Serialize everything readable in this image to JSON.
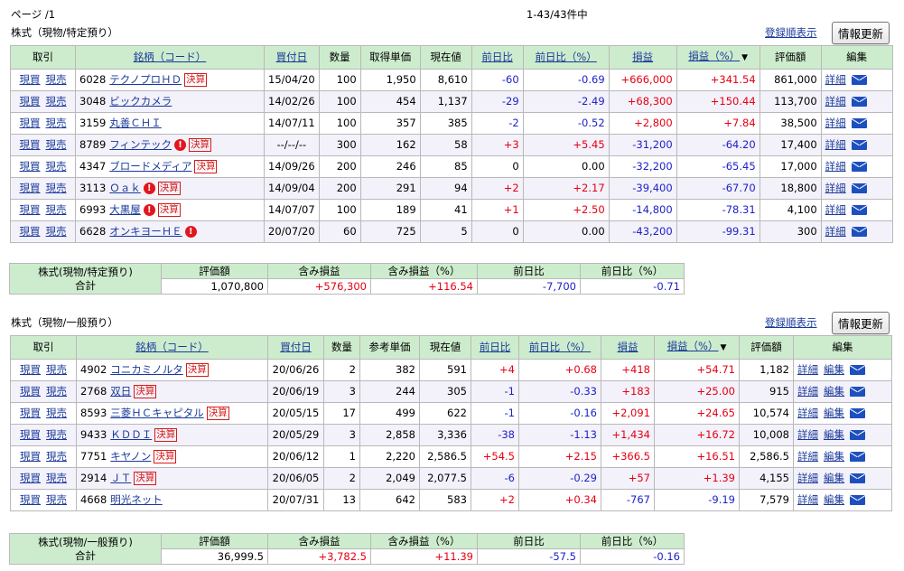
{
  "pager": {
    "left": "ページ /1",
    "count": "1-43/43件中"
  },
  "shared": {
    "buy": "現買",
    "sell": "現売",
    "detail": "詳細",
    "edit": "編集",
    "kessan": "決算",
    "alert": "!",
    "sort_glyph": "▼",
    "sort_link": "登録順表示",
    "refresh_button": "情報更新"
  },
  "colors": {
    "header_bg": "#cdeccd",
    "positive": "#e60012",
    "negative": "#1e22c8",
    "link": "#1a3a9a"
  },
  "tokutei": {
    "title": "株式（現物/特定預り）",
    "headers": [
      "取引",
      "銘柄（コード）",
      "買付日",
      "数量",
      "取得単価",
      "現在値",
      "前日比",
      "前日比（%）",
      "損益",
      "損益（%）",
      "評価額",
      "編集"
    ],
    "rows": [
      {
        "code": "6028",
        "name": "テクノプロＨＤ",
        "kessan": true,
        "alert": false,
        "date": "15/04/20",
        "qty": "100",
        "unit": "1,950",
        "price": "8,610",
        "chg": "-60",
        "chgpct": "-0.69",
        "pl": "+666,000",
        "plpct": "+341.54",
        "value": "861,000"
      },
      {
        "code": "3048",
        "name": "ビックカメラ",
        "kessan": false,
        "alert": false,
        "date": "14/02/26",
        "qty": "100",
        "unit": "454",
        "price": "1,137",
        "chg": "-29",
        "chgpct": "-2.49",
        "pl": "+68,300",
        "plpct": "+150.44",
        "value": "113,700"
      },
      {
        "code": "3159",
        "name": "丸善ＣＨＩ",
        "kessan": false,
        "alert": false,
        "date": "14/07/11",
        "qty": "100",
        "unit": "357",
        "price": "385",
        "chg": "-2",
        "chgpct": "-0.52",
        "pl": "+2,800",
        "plpct": "+7.84",
        "value": "38,500"
      },
      {
        "code": "8789",
        "name": "フィンテック",
        "kessan": true,
        "alert": true,
        "date": "--/--/--",
        "qty": "300",
        "unit": "162",
        "price": "58",
        "chg": "+3",
        "chgpct": "+5.45",
        "pl": "-31,200",
        "plpct": "-64.20",
        "value": "17,400"
      },
      {
        "code": "4347",
        "name": "ブロードメディア",
        "kessan": true,
        "alert": false,
        "date": "14/09/26",
        "qty": "200",
        "unit": "246",
        "price": "85",
        "chg": "0",
        "chgpct": "0.00",
        "pl": "-32,200",
        "plpct": "-65.45",
        "value": "17,000"
      },
      {
        "code": "3113",
        "name": "Ｏａｋ",
        "kessan": true,
        "alert": true,
        "date": "14/09/04",
        "qty": "200",
        "unit": "291",
        "price": "94",
        "chg": "+2",
        "chgpct": "+2.17",
        "pl": "-39,400",
        "plpct": "-67.70",
        "value": "18,800"
      },
      {
        "code": "6993",
        "name": "大黒屋",
        "kessan": true,
        "alert": true,
        "date": "14/07/07",
        "qty": "100",
        "unit": "189",
        "price": "41",
        "chg": "+1",
        "chgpct": "+2.50",
        "pl": "-14,800",
        "plpct": "-78.31",
        "value": "4,100"
      },
      {
        "code": "6628",
        "name": "オンキヨーＨＥ",
        "kessan": false,
        "alert": true,
        "date": "20/07/20",
        "qty": "60",
        "unit": "725",
        "price": "5",
        "chg": "0",
        "chgpct": "0.00",
        "pl": "-43,200",
        "plpct": "-99.31",
        "value": "300"
      }
    ],
    "summary": {
      "label_top": "株式(現物/特定預り)",
      "label_bottom": "合計",
      "headers": [
        "評価額",
        "含み損益",
        "含み損益（%）",
        "前日比",
        "前日比（%）"
      ],
      "values": [
        "1,070,800",
        "+576,300",
        "+116.54",
        "-7,700",
        "-0.71"
      ]
    }
  },
  "ippan": {
    "title": "株式（現物/一般預り）",
    "headers": [
      "取引",
      "銘柄（コード）",
      "買付日",
      "数量",
      "参考単価",
      "現在値",
      "前日比",
      "前日比（%）",
      "損益",
      "損益（%）",
      "評価額",
      "編集"
    ],
    "rows": [
      {
        "code": "4902",
        "name": "コニカミノルタ",
        "kessan": true,
        "alert": false,
        "date": "20/06/26",
        "qty": "2",
        "unit": "382",
        "price": "591",
        "chg": "+4",
        "chgpct": "+0.68",
        "pl": "+418",
        "plpct": "+54.71",
        "value": "1,182"
      },
      {
        "code": "2768",
        "name": "双日",
        "kessan": true,
        "alert": false,
        "date": "20/06/19",
        "qty": "3",
        "unit": "244",
        "price": "305",
        "chg": "-1",
        "chgpct": "-0.33",
        "pl": "+183",
        "plpct": "+25.00",
        "value": "915"
      },
      {
        "code": "8593",
        "name": "三菱ＨＣキャピタル",
        "kessan": true,
        "alert": false,
        "date": "20/05/15",
        "qty": "17",
        "unit": "499",
        "price": "622",
        "chg": "-1",
        "chgpct": "-0.16",
        "pl": "+2,091",
        "plpct": "+24.65",
        "value": "10,574"
      },
      {
        "code": "9433",
        "name": "ＫＤＤＩ",
        "kessan": true,
        "alert": false,
        "date": "20/05/29",
        "qty": "3",
        "unit": "2,858",
        "price": "3,336",
        "chg": "-38",
        "chgpct": "-1.13",
        "pl": "+1,434",
        "plpct": "+16.72",
        "value": "10,008"
      },
      {
        "code": "7751",
        "name": "キヤノン",
        "kessan": true,
        "alert": false,
        "date": "20/06/12",
        "qty": "1",
        "unit": "2,220",
        "price": "2,586.5",
        "chg": "+54.5",
        "chgpct": "+2.15",
        "pl": "+366.5",
        "plpct": "+16.51",
        "value": "2,586.5"
      },
      {
        "code": "2914",
        "name": "ＪＴ",
        "kessan": true,
        "alert": false,
        "date": "20/06/05",
        "qty": "2",
        "unit": "2,049",
        "price": "2,077.5",
        "chg": "-6",
        "chgpct": "-0.29",
        "pl": "+57",
        "plpct": "+1.39",
        "value": "4,155"
      },
      {
        "code": "4668",
        "name": "明光ネット",
        "kessan": false,
        "alert": false,
        "date": "20/07/31",
        "qty": "13",
        "unit": "642",
        "price": "583",
        "chg": "+2",
        "chgpct": "+0.34",
        "pl": "-767",
        "plpct": "-9.19",
        "value": "7,579"
      }
    ],
    "summary": {
      "label_top": "株式(現物/一般預り)",
      "label_bottom": "合計",
      "headers": [
        "評価額",
        "含み損益",
        "含み損益（%）",
        "前日比",
        "前日比（%）"
      ],
      "values": [
        "36,999.5",
        "+3,782.5",
        "+11.39",
        "-57.5",
        "-0.16"
      ]
    }
  }
}
